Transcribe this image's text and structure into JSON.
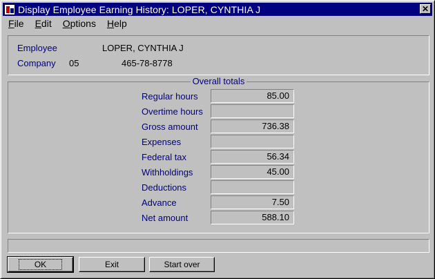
{
  "window": {
    "title": "Display Employee Earning History:  LOPER, CYNTHIA J",
    "close_symbol": "✕",
    "icon": "app-icon"
  },
  "menu": [
    {
      "u": "F",
      "rest": "ile"
    },
    {
      "u": "E",
      "rest": "dit"
    },
    {
      "u": "O",
      "rest": "ptions"
    },
    {
      "u": "H",
      "rest": "elp"
    }
  ],
  "header": {
    "employee_label": "Employee",
    "employee_name": "LOPER, CYNTHIA J",
    "company_label": "Company",
    "company_code": "05",
    "company_id": "465-78-8778"
  },
  "totals": {
    "caption": "Overall totals",
    "rows": [
      {
        "label": "Regular hours",
        "value": "85.00"
      },
      {
        "label": "Overtime hours",
        "value": ""
      },
      {
        "label": "Gross amount",
        "value": "736.38"
      },
      {
        "label": "Expenses",
        "value": ""
      },
      {
        "label": "Federal tax",
        "value": "56.34"
      },
      {
        "label": "Withholdings",
        "value": "45.00"
      },
      {
        "label": "Deductions",
        "value": ""
      },
      {
        "label": "Advance",
        "value": "7.50"
      },
      {
        "label": "Net amount",
        "value": "588.10"
      }
    ]
  },
  "buttons": {
    "ok": "OK",
    "exit": "Exit",
    "start_over": "Start over"
  },
  "colors": {
    "titlebar": "#000080",
    "label_text": "#000080",
    "face": "#c0c0c0"
  }
}
